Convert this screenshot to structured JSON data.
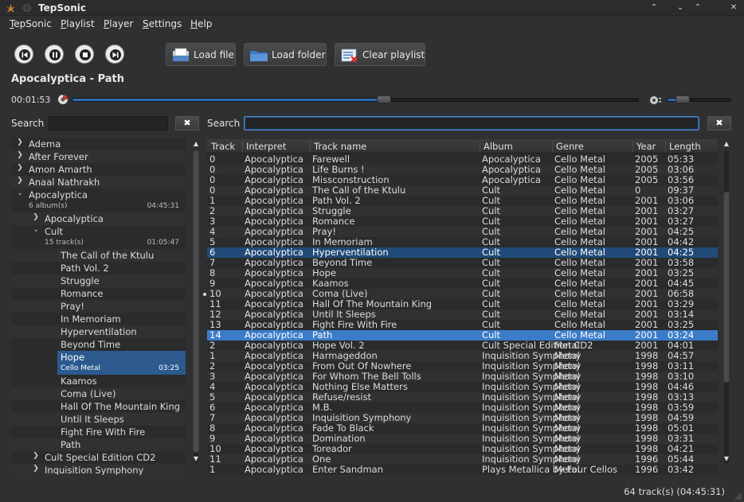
{
  "window": {
    "title": "TepSonic"
  },
  "menu": [
    "TepSonic",
    "Playlist",
    "Player",
    "Settings",
    "Help"
  ],
  "toolbar": {
    "load_file": "Load file",
    "load_folder": "Load folder",
    "clear_playlist": "Clear playlist"
  },
  "now_playing": "Apocalyptica - Path",
  "seek": {
    "elapsed": "00:01:53",
    "progress": 0.58
  },
  "volume": {
    "level": 0.25
  },
  "collection_search": {
    "label": "Search",
    "value": ""
  },
  "playlist_search": {
    "label": "Search",
    "value": ""
  },
  "tree": {
    "artists_top": [
      "Adema",
      "After Forever",
      "Amon Amarth",
      "Anaal Nathrakh"
    ],
    "expanded_artist": {
      "name": "Apocalyptica",
      "info": "6 album(s)",
      "duration": "04:45:31"
    },
    "album_collapsed_first": "Apocalyptica",
    "expanded_album": {
      "name": "Cult",
      "info": "15 track(s)",
      "duration": "01:05:47"
    },
    "tracks_before": [
      "The Call of the Ktulu",
      "Path Vol. 2",
      "Struggle",
      "Romance",
      "Pray!",
      "In Memoriam",
      "Hyperventilation",
      "Beyond Time"
    ],
    "selected_track": {
      "name": "Hope",
      "genre": "Cello Metal",
      "duration": "03:25"
    },
    "tracks_after": [
      "Kaamos",
      "Coma (Live)",
      "Hall Of The Mountain King",
      "Until It Sleeps",
      "Fight Fire With Fire",
      "Path"
    ],
    "albums_after": [
      "Cult Special Edition CD2",
      "Inquisition Symphony"
    ]
  },
  "playlist": {
    "columns": [
      "Track",
      "Interpret",
      "Track name",
      "Album",
      "Genre",
      "Year",
      "Length"
    ],
    "rows": [
      [
        "0",
        "Apocalyptica",
        "Farewell",
        "Apocalyptica",
        "Cello Metal",
        "2005",
        "05:33"
      ],
      [
        "0",
        "Apocalyptica",
        "Life Burns !",
        "Apocalyptica",
        "Cello Metal",
        "2005",
        "03:06"
      ],
      [
        "0",
        "Apocalyptica",
        "Missconstruction",
        "Apocalyptica",
        "Cello Metal",
        "2005",
        "03:56"
      ],
      [
        "0",
        "Apocalyptica",
        "The Call of the Ktulu",
        "Cult",
        "Cello Metal",
        "0",
        "09:37"
      ],
      [
        "1",
        "Apocalyptica",
        "Path Vol. 2",
        "Cult",
        "Cello Metal",
        "2001",
        "03:06"
      ],
      [
        "2",
        "Apocalyptica",
        "Struggle",
        "Cult",
        "Cello Metal",
        "2001",
        "03:27"
      ],
      [
        "3",
        "Apocalyptica",
        "Romance",
        "Cult",
        "Cello Metal",
        "2001",
        "03:27"
      ],
      [
        "4",
        "Apocalyptica",
        "Pray!",
        "Cult",
        "Cello Metal",
        "2001",
        "04:25"
      ],
      [
        "5",
        "Apocalyptica",
        "In Memoriam",
        "Cult",
        "Cello Metal",
        "2001",
        "04:42"
      ],
      [
        "6",
        "Apocalyptica",
        "Hyperventilation",
        "Cult",
        "Cello Metal",
        "2001",
        "04:25"
      ],
      [
        "7",
        "Apocalyptica",
        "Beyond Time",
        "Cult",
        "Cello Metal",
        "2001",
        "03:58"
      ],
      [
        "8",
        "Apocalyptica",
        "Hope",
        "Cult",
        "Cello Metal",
        "2001",
        "03:25"
      ],
      [
        "9",
        "Apocalyptica",
        "Kaamos",
        "Cult",
        "Cello Metal",
        "2001",
        "04:45"
      ],
      [
        "10",
        "Apocalyptica",
        "Coma (Live)",
        "Cult",
        "Cello Metal",
        "2001",
        "06:58"
      ],
      [
        "11",
        "Apocalyptica",
        "Hall Of The Mountain King",
        "Cult",
        "Cello Metal",
        "2001",
        "03:29"
      ],
      [
        "12",
        "Apocalyptica",
        "Until It Sleeps",
        "Cult",
        "Cello Metal",
        "2001",
        "03:14"
      ],
      [
        "13",
        "Apocalyptica",
        "Fight Fire With Fire",
        "Cult",
        "Cello Metal",
        "2001",
        "03:25"
      ],
      [
        "14",
        "Apocalyptica",
        "Path",
        "Cult",
        "Cello Metal",
        "2001",
        "03:24"
      ],
      [
        "2",
        "Apocalyptica",
        "Hope Vol. 2",
        "Cult Special Edition CD2",
        "Metal",
        "2001",
        "04:01"
      ],
      [
        "1",
        "Apocalyptica",
        "Harmageddon",
        "Inquisition Symphony",
        "Metal",
        "1998",
        "04:57"
      ],
      [
        "2",
        "Apocalyptica",
        "From Out Of Nowhere",
        "Inquisition Symphony",
        "Metal",
        "1998",
        "03:11"
      ],
      [
        "3",
        "Apocalyptica",
        "For Whom The Bell Tolls",
        "Inquisition Symphony",
        "Metal",
        "1998",
        "03:10"
      ],
      [
        "4",
        "Apocalyptica",
        "Nothing Else Matters",
        "Inquisition Symphony",
        "Metal",
        "1998",
        "04:46"
      ],
      [
        "5",
        "Apocalyptica",
        "Refuse/resist",
        "Inquisition Symphony",
        "Metal",
        "1998",
        "03:13"
      ],
      [
        "6",
        "Apocalyptica",
        "M.B.",
        "Inquisition Symphony",
        "Metal",
        "1998",
        "03:59"
      ],
      [
        "7",
        "Apocalyptica",
        "Inquisition Symphony",
        "Inquisition Symphony",
        "Metal",
        "1998",
        "04:59"
      ],
      [
        "8",
        "Apocalyptica",
        "Fade To Black",
        "Inquisition Symphony",
        "Metal",
        "1998",
        "05:01"
      ],
      [
        "9",
        "Apocalyptica",
        "Domination",
        "Inquisition Symphony",
        "Metal",
        "1998",
        "03:31"
      ],
      [
        "10",
        "Apocalyptica",
        "Toreador",
        "Inquisition Symphony",
        "Metal",
        "1998",
        "04:21"
      ],
      [
        "11",
        "Apocalyptica",
        "One",
        "Inquisition Symphony",
        "Metal",
        "1996",
        "05:44"
      ],
      [
        "1",
        "Apocalyptica",
        "Enter Sandman",
        "Plays Metallica by Four Cellos",
        "Metal",
        "1996",
        "03:42"
      ]
    ],
    "hover_row": 9,
    "selected_row": 17,
    "playing_row": 13
  },
  "status": "64 track(s) (04:45:31)",
  "colors": {
    "selection": "#3b7cc9",
    "highlight": "#214a78",
    "tree_selection": "#2c5a8f",
    "accent": "#2b6bb5"
  },
  "icons": [
    "app-icon",
    "minimize-icon",
    "maximize-icon",
    "close-icon",
    "previous-icon",
    "pause-icon",
    "stop-icon",
    "next-icon",
    "file-icon",
    "folder-icon",
    "clear-playlist-icon",
    "seek-icon",
    "volume-icon",
    "clear-search-icon"
  ]
}
